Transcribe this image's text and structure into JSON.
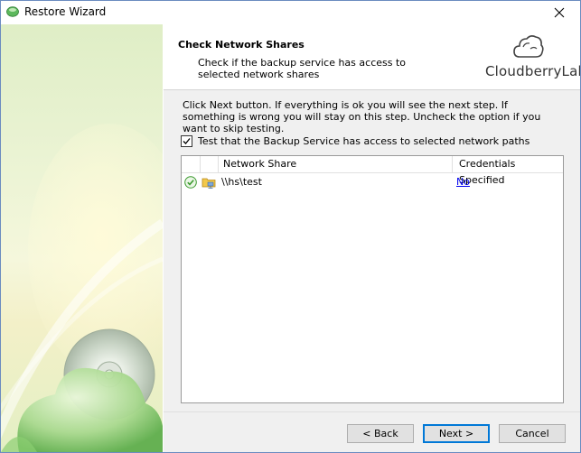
{
  "window": {
    "title": "Restore Wizard"
  },
  "header": {
    "title": "Check Network Shares",
    "description": "Check if the backup service has access to selected network shares",
    "logo_text": "CloudberryLab"
  },
  "content": {
    "instructions": "Click Next button. If everything is ok you will see the next step. If something is wrong you will stay on this step. Uncheck the option if you want to skip testing.",
    "checkbox_label": "Test that the Backup Service has access to selected network paths",
    "checkbox_checked": true
  },
  "grid": {
    "columns": [
      "",
      "",
      "Network Share",
      "Credentials Specified"
    ],
    "rows": [
      {
        "status": "ok-icon",
        "icon": "network-folder-icon",
        "network_share": "\\\\hs\\test",
        "credentials": "No"
      }
    ]
  },
  "footer": {
    "back": "< Back",
    "next": "Next >",
    "cancel": "Cancel"
  },
  "colors": {
    "accent": "#0078d7",
    "link": "#0000ee",
    "ok_green": "#3c9a2f"
  }
}
